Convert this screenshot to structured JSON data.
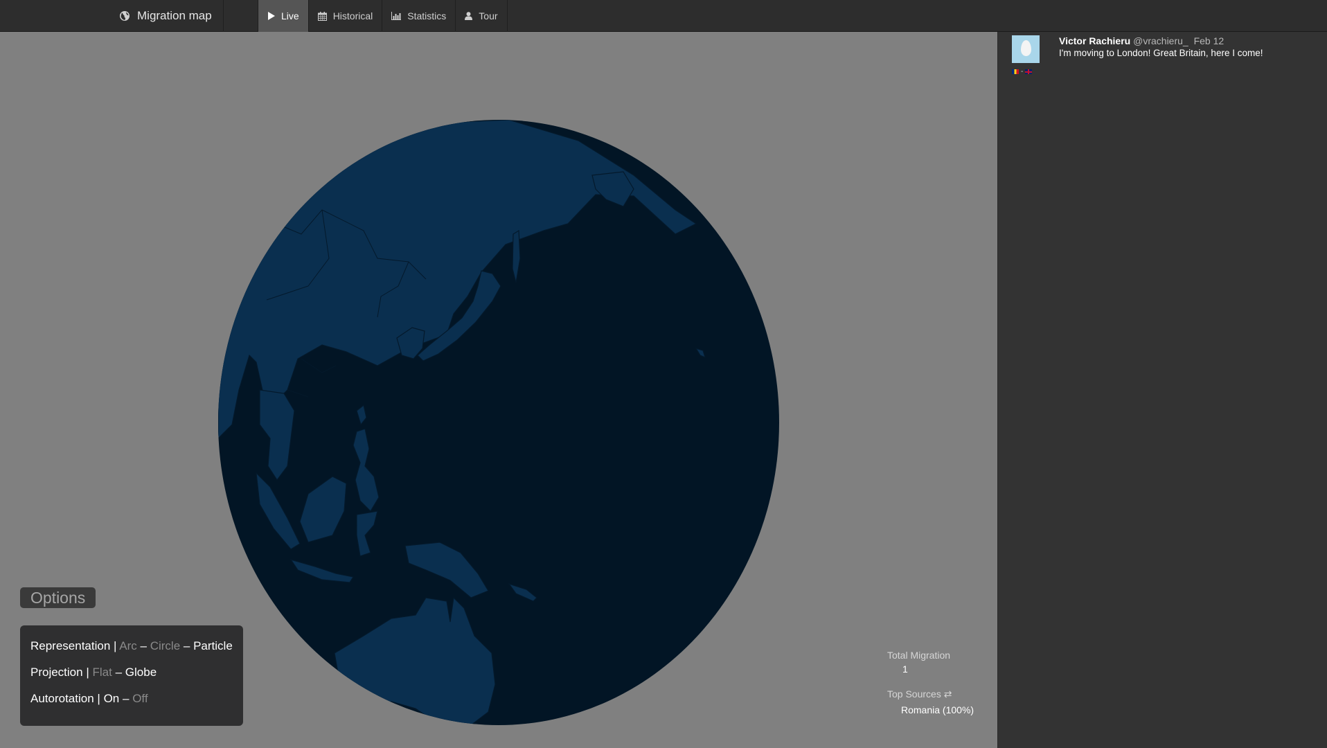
{
  "app": {
    "title": "Migration map",
    "icon": "globe-icon"
  },
  "nav": {
    "items": [
      {
        "label": "Live",
        "icon": "play-icon",
        "active": true
      },
      {
        "label": "Historical",
        "icon": "calendar-icon",
        "active": false
      },
      {
        "label": "Statistics",
        "icon": "bar-chart-icon",
        "active": false
      },
      {
        "label": "Tour",
        "icon": "user-icon",
        "active": false
      }
    ]
  },
  "tweet": {
    "name": "Victor Rachieru",
    "handle": "@vrachieru_",
    "date": "Feb 12",
    "text": "I'm moving to London! Great Britain, here I come!",
    "flag_separator": "-",
    "from_flag": "Romania",
    "to_flag": "United Kingdom"
  },
  "options": {
    "title": "Options",
    "representation": {
      "label": "Representation",
      "separator": "|",
      "dash": "–",
      "choices": [
        "Arc",
        "Circle",
        "Particle"
      ],
      "selected": "Particle"
    },
    "projection": {
      "label": "Projection",
      "separator": "|",
      "dash": "–",
      "choices": [
        "Flat",
        "Globe"
      ],
      "selected": "Globe"
    },
    "autorotation": {
      "label": "Autorotation",
      "separator": "|",
      "dash": "–",
      "choices": [
        "On",
        "Off"
      ],
      "selected": "On"
    }
  },
  "stats": {
    "total_label": "Total Migration",
    "total_value": "1",
    "top_sources_label": "Top Sources ⇄",
    "top_sources_value": "Romania (100%)"
  },
  "colors": {
    "page_background": "#808080",
    "navbar": "#2d2d2d",
    "sidebar": "#333333",
    "ocean": "#021525",
    "land": "#0a2f4f",
    "borders": "#04192b"
  }
}
